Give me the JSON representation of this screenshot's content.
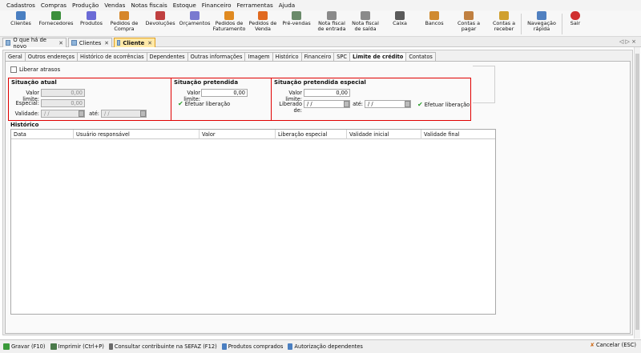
{
  "menu": [
    "Cadastros",
    "Compras",
    "Produção",
    "Vendas",
    "Notas fiscais",
    "Estoque",
    "Financeiro",
    "Ferramentas",
    "Ajuda"
  ],
  "toolbar": [
    {
      "label": "Clientes",
      "icon": "clients-icon",
      "color": "#4a7fc1"
    },
    {
      "label": "Fornecedores",
      "icon": "suppliers-icon",
      "color": "#3c8f3c"
    },
    {
      "label": "Produtos",
      "icon": "products-icon",
      "color": "#6b6bd6"
    },
    {
      "label": "Pedidos de Compra",
      "icon": "purchase-order-icon",
      "color": "#d6862a"
    },
    {
      "label": "Devoluções",
      "icon": "returns-icon",
      "color": "#c04040"
    },
    {
      "label": "Orçamentos",
      "icon": "quotes-icon",
      "color": "#7a7ad0"
    },
    {
      "label": "Pedidos de Faturamento",
      "icon": "billing-order-icon",
      "color": "#e08a20"
    },
    {
      "label": "Pedidos de Venda",
      "icon": "sales-order-icon",
      "color": "#e06a20"
    },
    {
      "label": "Pré-vendas",
      "icon": "pre-sales-icon",
      "color": "#6a8a6a"
    },
    {
      "label": "Nota fiscal de entrada",
      "icon": "invoice-in-icon",
      "color": "#8a8a8a"
    },
    {
      "label": "Nota fiscal de saída",
      "icon": "invoice-out-icon",
      "color": "#8a8a8a"
    },
    {
      "label": "Caixa",
      "icon": "cash-icon",
      "color": "#5a5a5a"
    },
    {
      "label": "Bancos",
      "icon": "bank-icon",
      "color": "#d08a30"
    },
    {
      "label": "Contas a pagar",
      "icon": "payables-icon",
      "color": "#c08040"
    },
    {
      "label": "Contas a receber",
      "icon": "receivables-icon",
      "color": "#d0a030"
    },
    {
      "label": "Navegação rápida",
      "icon": "quick-nav-icon",
      "color": "#5080c0"
    },
    {
      "label": "Sair",
      "icon": "exit-icon",
      "color": "#d03030"
    }
  ],
  "doc_tabs": [
    "O que há de novo",
    "Clientes",
    "Cliente"
  ],
  "sub_tabs": [
    "Geral",
    "Outros endereços",
    "Histórico de ocorrências",
    "Dependentes",
    "Outras informações",
    "Imagem",
    "Histórico",
    "Financeiro",
    "SPC",
    "Limite de crédito",
    "Contatos"
  ],
  "liberar_atrasos": "Liberar atrasos",
  "situacao_atual": {
    "title": "Situação atual",
    "valor_limite_label": "Valor limite:",
    "valor_limite": "0,00",
    "especial_label": "Especial:",
    "especial": "0,00",
    "validade_label": "Validade:",
    "validade_de": " / /",
    "ate_label": "até:",
    "validade_ate": " / /"
  },
  "situacao_pretendida": {
    "title": "Situação pretendida",
    "valor_limite_label": "Valor limite:",
    "valor_limite": "0,00",
    "button": "Efetuar liberação"
  },
  "situacao_especial": {
    "title": "Situação pretendida especial",
    "valor_limite_label": "Valor limite:",
    "valor_limite": "0,00",
    "liberado_de_label": "Liberado de:",
    "liberado_de": " / /",
    "ate_label": "até:",
    "ate": " / /",
    "button": "Efetuar liberação"
  },
  "historico": {
    "title": "Histórico",
    "columns": [
      "Data",
      "Usuário responsável",
      "Valor",
      "Liberação especial",
      "Validade inicial",
      "Validade final"
    ]
  },
  "bottom_actions": [
    {
      "label": "Gravar (F10)",
      "icon": "save-icon",
      "color": "#3a9a3a"
    },
    {
      "label": "Imprimir (Ctrl+P)",
      "icon": "print-icon",
      "color": "#4a7a4a"
    },
    {
      "label": "Consultar contribuinte na SEFAZ (F12)",
      "icon": "sefaz-icon",
      "color": "#6a6a6a"
    },
    {
      "label": "Produtos comprados",
      "icon": "products-bought-icon",
      "color": "#4a7fc1"
    },
    {
      "label": "Autorização dependentes",
      "icon": "dependents-auth-icon",
      "color": "#4a7fc1"
    }
  ],
  "cancel": "Cancelar (ESC)",
  "nav_arrows": "◁ ▷ ×"
}
